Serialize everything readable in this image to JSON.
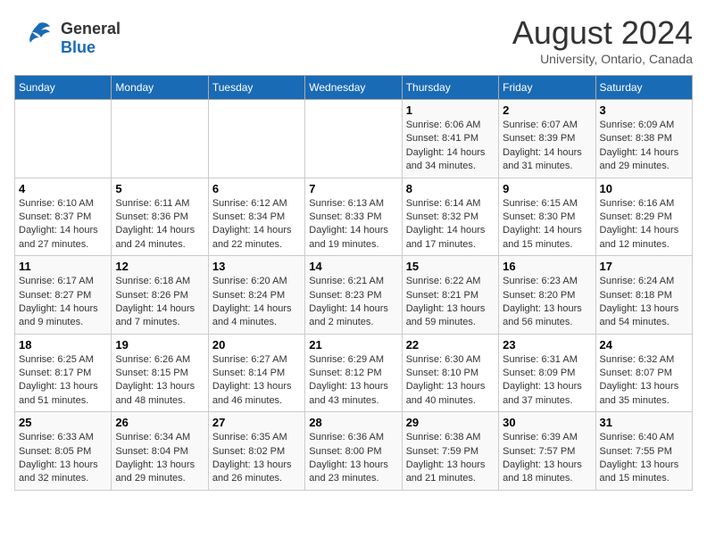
{
  "logo": {
    "general": "General",
    "blue": "Blue"
  },
  "title": "August 2024",
  "subtitle": "University, Ontario, Canada",
  "days_of_week": [
    "Sunday",
    "Monday",
    "Tuesday",
    "Wednesday",
    "Thursday",
    "Friday",
    "Saturday"
  ],
  "weeks": [
    [
      {
        "day": "",
        "info": ""
      },
      {
        "day": "",
        "info": ""
      },
      {
        "day": "",
        "info": ""
      },
      {
        "day": "",
        "info": ""
      },
      {
        "day": "1",
        "info": "Sunrise: 6:06 AM\nSunset: 8:41 PM\nDaylight: 14 hours and 34 minutes."
      },
      {
        "day": "2",
        "info": "Sunrise: 6:07 AM\nSunset: 8:39 PM\nDaylight: 14 hours and 31 minutes."
      },
      {
        "day": "3",
        "info": "Sunrise: 6:09 AM\nSunset: 8:38 PM\nDaylight: 14 hours and 29 minutes."
      }
    ],
    [
      {
        "day": "4",
        "info": "Sunrise: 6:10 AM\nSunset: 8:37 PM\nDaylight: 14 hours and 27 minutes."
      },
      {
        "day": "5",
        "info": "Sunrise: 6:11 AM\nSunset: 8:36 PM\nDaylight: 14 hours and 24 minutes."
      },
      {
        "day": "6",
        "info": "Sunrise: 6:12 AM\nSunset: 8:34 PM\nDaylight: 14 hours and 22 minutes."
      },
      {
        "day": "7",
        "info": "Sunrise: 6:13 AM\nSunset: 8:33 PM\nDaylight: 14 hours and 19 minutes."
      },
      {
        "day": "8",
        "info": "Sunrise: 6:14 AM\nSunset: 8:32 PM\nDaylight: 14 hours and 17 minutes."
      },
      {
        "day": "9",
        "info": "Sunrise: 6:15 AM\nSunset: 8:30 PM\nDaylight: 14 hours and 15 minutes."
      },
      {
        "day": "10",
        "info": "Sunrise: 6:16 AM\nSunset: 8:29 PM\nDaylight: 14 hours and 12 minutes."
      }
    ],
    [
      {
        "day": "11",
        "info": "Sunrise: 6:17 AM\nSunset: 8:27 PM\nDaylight: 14 hours and 9 minutes."
      },
      {
        "day": "12",
        "info": "Sunrise: 6:18 AM\nSunset: 8:26 PM\nDaylight: 14 hours and 7 minutes."
      },
      {
        "day": "13",
        "info": "Sunrise: 6:20 AM\nSunset: 8:24 PM\nDaylight: 14 hours and 4 minutes."
      },
      {
        "day": "14",
        "info": "Sunrise: 6:21 AM\nSunset: 8:23 PM\nDaylight: 14 hours and 2 minutes."
      },
      {
        "day": "15",
        "info": "Sunrise: 6:22 AM\nSunset: 8:21 PM\nDaylight: 13 hours and 59 minutes."
      },
      {
        "day": "16",
        "info": "Sunrise: 6:23 AM\nSunset: 8:20 PM\nDaylight: 13 hours and 56 minutes."
      },
      {
        "day": "17",
        "info": "Sunrise: 6:24 AM\nSunset: 8:18 PM\nDaylight: 13 hours and 54 minutes."
      }
    ],
    [
      {
        "day": "18",
        "info": "Sunrise: 6:25 AM\nSunset: 8:17 PM\nDaylight: 13 hours and 51 minutes."
      },
      {
        "day": "19",
        "info": "Sunrise: 6:26 AM\nSunset: 8:15 PM\nDaylight: 13 hours and 48 minutes."
      },
      {
        "day": "20",
        "info": "Sunrise: 6:27 AM\nSunset: 8:14 PM\nDaylight: 13 hours and 46 minutes."
      },
      {
        "day": "21",
        "info": "Sunrise: 6:29 AM\nSunset: 8:12 PM\nDaylight: 13 hours and 43 minutes."
      },
      {
        "day": "22",
        "info": "Sunrise: 6:30 AM\nSunset: 8:10 PM\nDaylight: 13 hours and 40 minutes."
      },
      {
        "day": "23",
        "info": "Sunrise: 6:31 AM\nSunset: 8:09 PM\nDaylight: 13 hours and 37 minutes."
      },
      {
        "day": "24",
        "info": "Sunrise: 6:32 AM\nSunset: 8:07 PM\nDaylight: 13 hours and 35 minutes."
      }
    ],
    [
      {
        "day": "25",
        "info": "Sunrise: 6:33 AM\nSunset: 8:05 PM\nDaylight: 13 hours and 32 minutes."
      },
      {
        "day": "26",
        "info": "Sunrise: 6:34 AM\nSunset: 8:04 PM\nDaylight: 13 hours and 29 minutes."
      },
      {
        "day": "27",
        "info": "Sunrise: 6:35 AM\nSunset: 8:02 PM\nDaylight: 13 hours and 26 minutes."
      },
      {
        "day": "28",
        "info": "Sunrise: 6:36 AM\nSunset: 8:00 PM\nDaylight: 13 hours and 23 minutes."
      },
      {
        "day": "29",
        "info": "Sunrise: 6:38 AM\nSunset: 7:59 PM\nDaylight: 13 hours and 21 minutes."
      },
      {
        "day": "30",
        "info": "Sunrise: 6:39 AM\nSunset: 7:57 PM\nDaylight: 13 hours and 18 minutes."
      },
      {
        "day": "31",
        "info": "Sunrise: 6:40 AM\nSunset: 7:55 PM\nDaylight: 13 hours and 15 minutes."
      }
    ]
  ]
}
